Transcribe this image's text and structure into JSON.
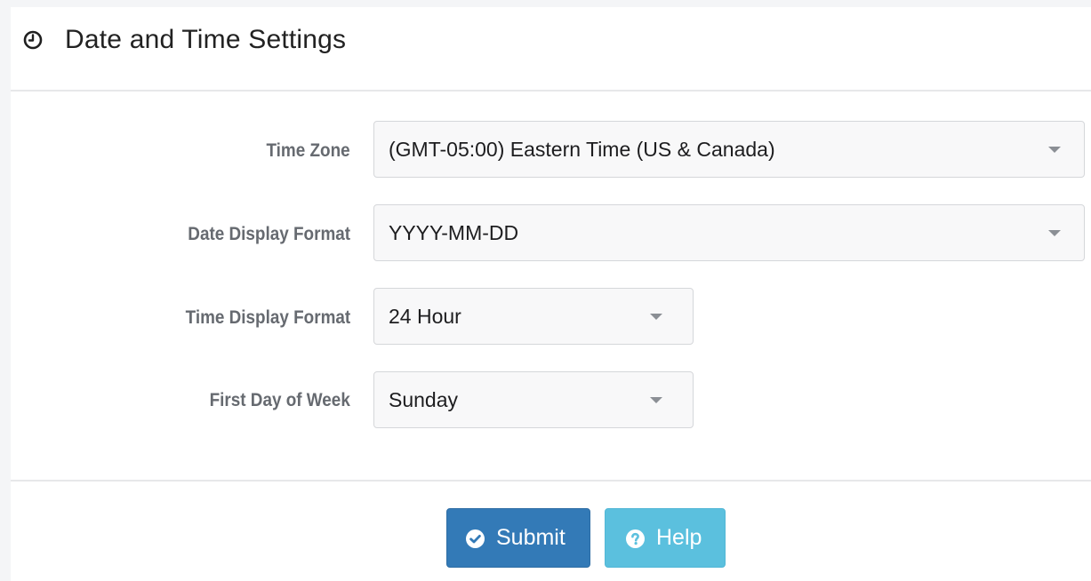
{
  "panel": {
    "title": "Date and Time Settings",
    "title_icon": "clock-icon"
  },
  "form": {
    "time_zone": {
      "label": "Time Zone",
      "value": "(GMT-05:00) Eastern Time (US & Canada)"
    },
    "date_format": {
      "label": "Date Display Format",
      "value": "YYYY-MM-DD"
    },
    "time_format": {
      "label": "Time Display Format",
      "value": "24 Hour"
    },
    "first_day": {
      "label": "First Day of Week",
      "value": "Sunday"
    }
  },
  "actions": {
    "submit": {
      "label": "Submit",
      "icon": "check-circle-icon"
    },
    "help": {
      "label": "Help",
      "icon": "question-circle-icon"
    }
  },
  "colors": {
    "submit_bg": "#337ab7",
    "help_bg": "#5bc0de",
    "label_text": "#666a70"
  }
}
